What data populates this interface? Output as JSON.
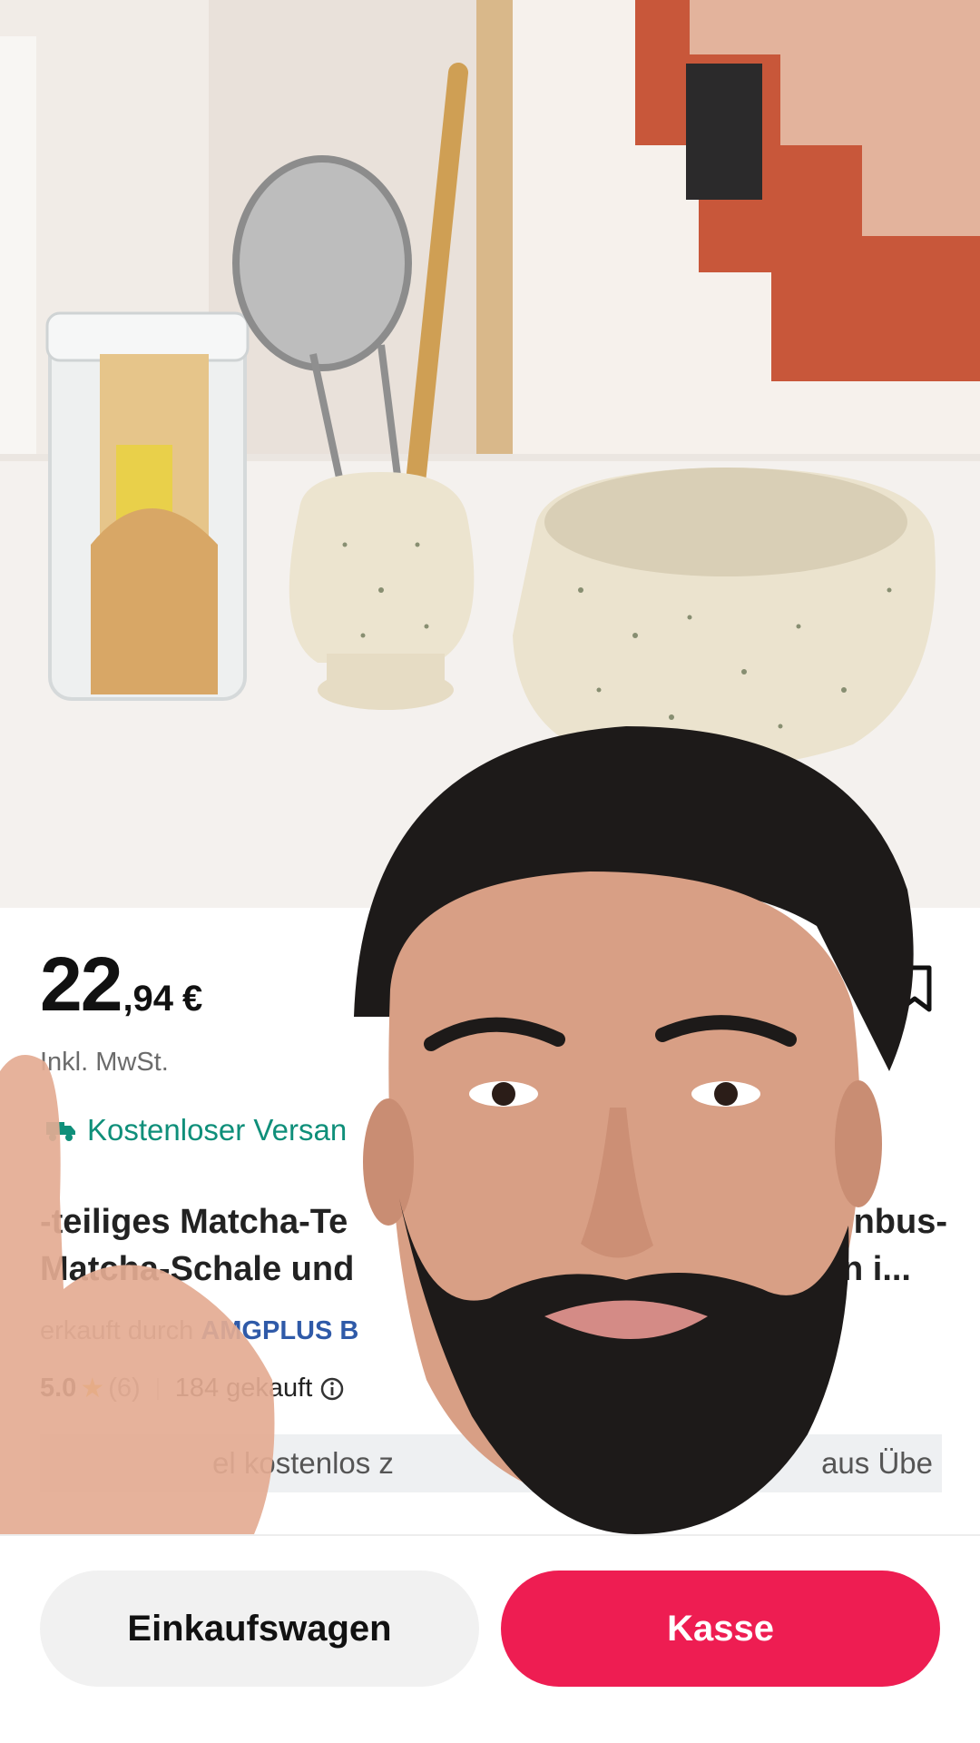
{
  "product": {
    "price_integer": "22",
    "price_decimal": ",94",
    "currency": "€",
    "tax_note": "Inkl. MwSt.",
    "shipping_label": "Kostenloser Versan",
    "title_line1": "-teiliges Matcha-Te",
    "title_line1_end": "nbus-",
    "title_line2": "Matcha-Schale und",
    "title_line2_end": "rn i...",
    "sold_by_prefix": "erkauft durch",
    "seller": "AMGPLUS B",
    "rating": "5.0",
    "review_count": "(6)",
    "sold_count": "184 gekauft",
    "promo_left": "el kostenlos z",
    "promo_right": "aus Übe"
  },
  "actions": {
    "cart_label": "Einkaufswagen",
    "checkout_label": "Kasse"
  },
  "icons": {
    "bookmark": "bookmark-icon",
    "shipping": "truck-icon",
    "rating": "star-icon",
    "info": "info-icon"
  },
  "colors": {
    "checkout": "#ee1d52",
    "shipping": "#0f8f7a",
    "seller": "#2f5aa8",
    "star": "#f6b500"
  }
}
